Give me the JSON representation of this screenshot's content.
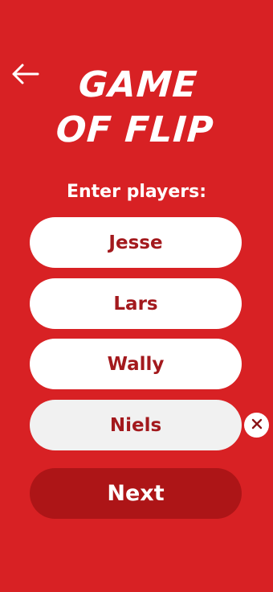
{
  "header": {
    "back_icon": "arrow-left-icon",
    "title_line1": "GAME",
    "title_line2": "OF FLIP"
  },
  "prompt": "Enter players:",
  "players": [
    {
      "name": "Jesse"
    },
    {
      "name": "Lars"
    },
    {
      "name": "Wally"
    },
    {
      "name": "Niels"
    }
  ],
  "remove_icon": "close-icon",
  "next_label": "Next",
  "colors": {
    "background": "#d82124",
    "field": "#ffffff",
    "field_active": "#f1f1f1",
    "player_text": "#a3191d",
    "next_button": "#ad1517",
    "text_light": "#ffffff"
  }
}
